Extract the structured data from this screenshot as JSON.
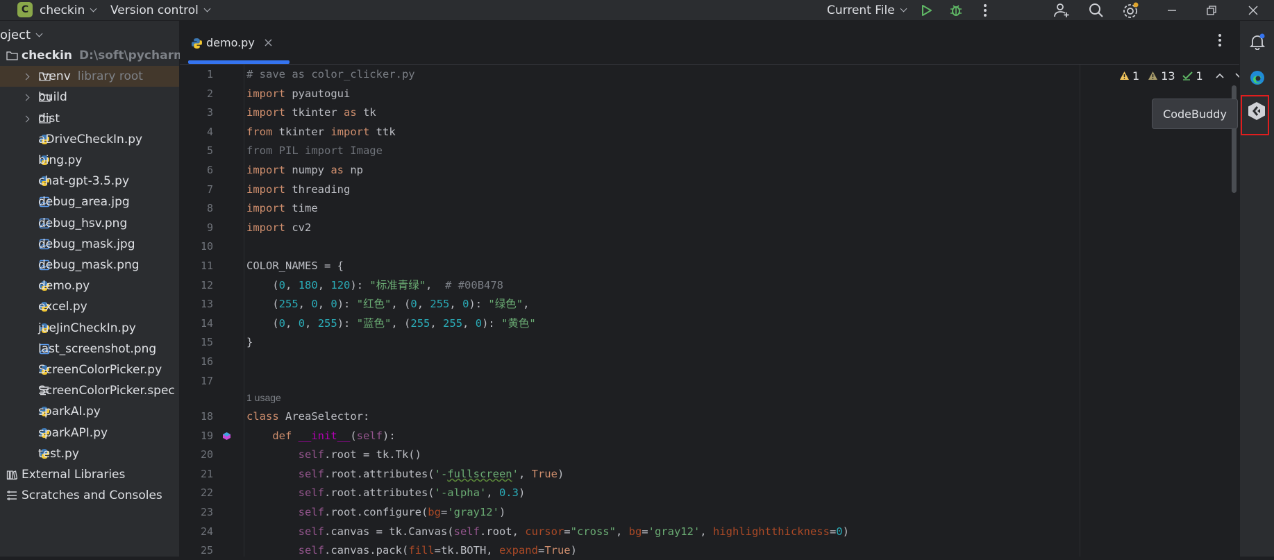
{
  "titlebar": {
    "project_badge": "C",
    "project_name": "checkin",
    "vcs_label": "Version control",
    "run_config": "Current File",
    "icons": [
      "run-icon",
      "debug-icon",
      "more-vertical-icon",
      "add-user-icon",
      "search-icon",
      "settings-icon",
      "minimize-icon",
      "restore-icon",
      "close-icon"
    ]
  },
  "project_pane": {
    "header": "oject",
    "rows": [
      {
        "label": "checkin",
        "hint": "D:\\soft\\pycharm\\Py",
        "type": "folder-open",
        "bold": true
      },
      {
        "label": ".venv",
        "hint": "library root",
        "type": "folder",
        "selected": true
      },
      {
        "label": "build",
        "type": "folder"
      },
      {
        "label": "dist",
        "type": "folder"
      },
      {
        "label": "aDriveCheckIn.py",
        "type": "python"
      },
      {
        "label": "bing.py",
        "type": "python"
      },
      {
        "label": "chat-gpt-3.5.py",
        "type": "python"
      },
      {
        "label": "debug_area.jpg",
        "type": "image"
      },
      {
        "label": "debug_hsv.png",
        "type": "image"
      },
      {
        "label": "debug_mask.jpg",
        "type": "image"
      },
      {
        "label": "debug_mask.png",
        "type": "image"
      },
      {
        "label": "demo.py",
        "type": "python"
      },
      {
        "label": "excel.py",
        "type": "python"
      },
      {
        "label": "jueJinCheckIn.py",
        "type": "python"
      },
      {
        "label": "last_screenshot.png",
        "type": "image"
      },
      {
        "label": "ScreenColorPicker.py",
        "type": "python"
      },
      {
        "label": "ScreenColorPicker.spec",
        "type": "text"
      },
      {
        "label": "sparkAI.py",
        "type": "python"
      },
      {
        "label": "sparkAPI.py",
        "type": "python"
      },
      {
        "label": "test.py",
        "type": "python"
      },
      {
        "label": "External Libraries",
        "type": "library"
      },
      {
        "label": "Scratches and Consoles",
        "type": "scratches"
      }
    ]
  },
  "editor": {
    "tab_label": "demo.py",
    "inspections": {
      "warnings": "1",
      "weak_warnings": "13",
      "ok": "1"
    },
    "usage_hint": "1 usage",
    "line_numbers": [
      "1",
      "2",
      "3",
      "4",
      "5",
      "6",
      "7",
      "8",
      "9",
      "10",
      "11",
      "12",
      "13",
      "14",
      "15",
      "16",
      "17",
      "18",
      "19",
      "20",
      "21",
      "22",
      "23",
      "24",
      "25"
    ]
  },
  "tooltip": {
    "text": "CodeBuddy"
  },
  "right_strip": {
    "icons": [
      "notifications-icon",
      "edge-browser-icon",
      "codebuddy-icon"
    ]
  }
}
